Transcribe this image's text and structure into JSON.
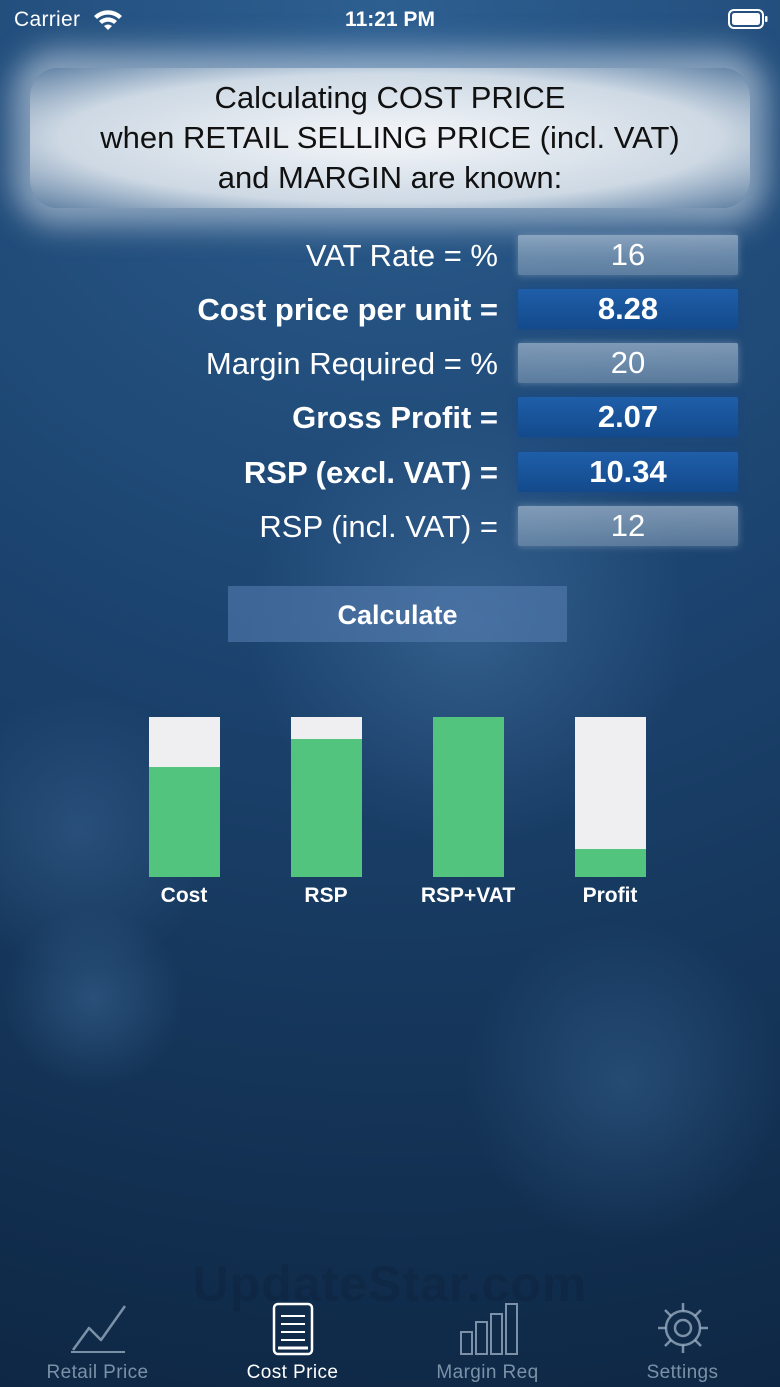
{
  "status_bar": {
    "carrier": "Carrier",
    "time": "11:21 PM"
  },
  "header": {
    "line1": "Calculating COST PRICE",
    "line2": "when RETAIL SELLING PRICE (incl. VAT)",
    "line3": "and MARGIN are known:"
  },
  "form": {
    "vat_rate": {
      "label": "VAT Rate = %",
      "value": "16"
    },
    "cost_price": {
      "label": "Cost price per unit =",
      "value": "8.28"
    },
    "margin": {
      "label": "Margin Required = %",
      "value": "20"
    },
    "gross_profit": {
      "label": "Gross Profit =",
      "value": "2.07"
    },
    "rsp_excl": {
      "label": "RSP (excl. VAT) =",
      "value": "10.34"
    },
    "rsp_incl": {
      "label": "RSP (incl. VAT) =",
      "value": "12"
    }
  },
  "calculate_label": "Calculate",
  "chart_data": {
    "type": "bar",
    "categories": [
      "Cost",
      "RSP",
      "RSP+VAT",
      "Profit"
    ],
    "values": [
      8.28,
      10.34,
      12,
      2.07
    ],
    "ylim": [
      0,
      12
    ],
    "fill_color": "#52c47d",
    "track_color": "#efeff1"
  },
  "watermark": "UpdateStar.com",
  "tabs": [
    {
      "label": "Retail Price",
      "icon": "line-chart-icon",
      "active": false
    },
    {
      "label": "Cost Price",
      "icon": "document-icon",
      "active": true
    },
    {
      "label": "Margin Req",
      "icon": "bar-chart-icon",
      "active": false
    },
    {
      "label": "Settings",
      "icon": "gear-icon",
      "active": false
    }
  ]
}
